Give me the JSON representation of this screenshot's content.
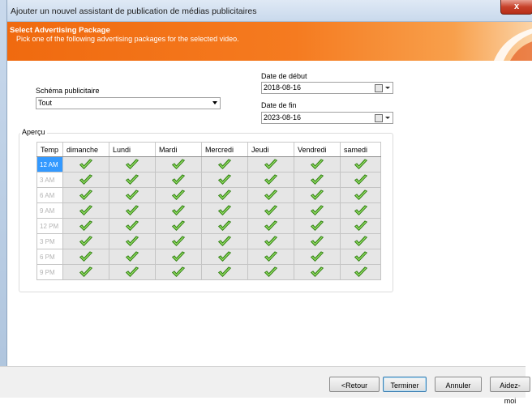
{
  "window": {
    "title": "Ajouter un nouvel assistant de publication de médias publicitaires",
    "close_label": "x"
  },
  "banner": {
    "title": "Select Advertising Package",
    "subtitle": "Pick one of the following advertising packages for the selected video."
  },
  "form": {
    "scheme_label": "Schéma publicitaire",
    "scheme_value": "Tout",
    "start_label": "Date de début",
    "start_value": "2018-08-16",
    "end_label": "Date de fin",
    "end_value": "2023-08-16"
  },
  "preview": {
    "label": "Aperçu",
    "columns": [
      "Temp",
      "dimanche",
      "Lundi",
      "Mardi",
      "Mercredi",
      "Jeudi",
      "Vendredi",
      "samedi"
    ],
    "rows": [
      "12 AM",
      "3 AM",
      "6 AM",
      "9 AM",
      "12 PM",
      "3 PM",
      "6 PM",
      "9 PM"
    ],
    "selected_row": "12 AM",
    "cell_icon": "check-icon",
    "check_color": "#5cb82e"
  },
  "footer": {
    "back": "<Retour",
    "finish": "Terminer",
    "cancel": "Annuler",
    "help": "Aidez-moi"
  },
  "colors": {
    "banner": "#f06a0f",
    "selection": "#3399ff"
  }
}
